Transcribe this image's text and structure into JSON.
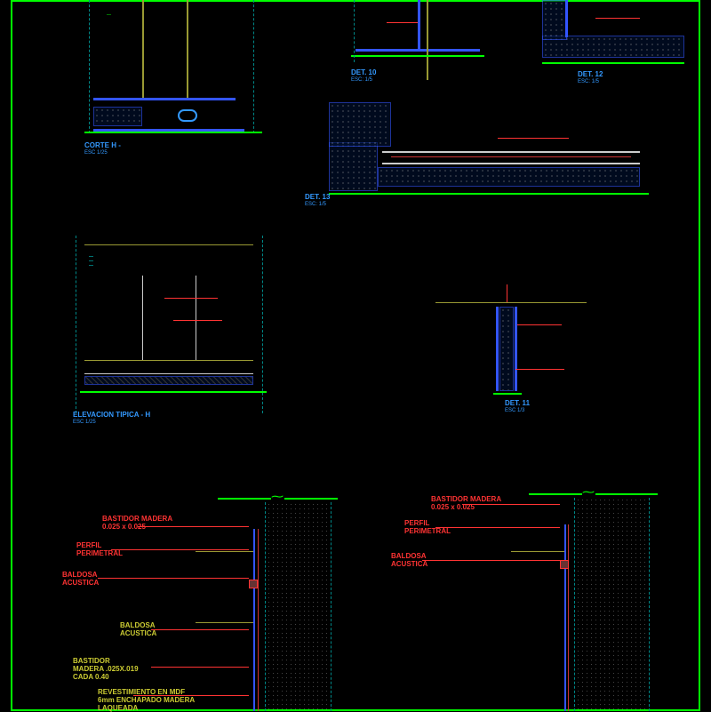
{
  "titles": {
    "corteH": {
      "main": "CORTE H -",
      "sub": "ESC 1/25"
    },
    "det10": {
      "main": "DET. 10",
      "sub": "ESC: 1/5"
    },
    "det12": {
      "main": "DET. 12",
      "sub": "ESC: 1/5"
    },
    "det13": {
      "main": "DET. 13",
      "sub": "ESC: 1/5"
    },
    "det11": {
      "main": "DET. 11",
      "sub": "ESC 1/3"
    },
    "elev": {
      "main": "ELEVACION TIPICA - H",
      "sub": "ESC 1/25"
    }
  },
  "labels": {
    "bastidor1": "BASTIDOR MADERA\n0.025 x 0.025",
    "perfilPer": "PERFIL\nPERIMETRAL",
    "baldosaAc": "BALDOSA\nACUSTICA",
    "bastidor2": "BASTIDOR\nMADERA .025X.019\nCADA 0.40",
    "revest": "REVESTIMIENTO EN MDF\n6mm ENCHAPADO MADERA\nLAQUEADA",
    "bastidor3": "BASTIDOR MADERA\n0.025 x 0.025",
    "perfilPer2": "PERFIL\nPERIMETRAL",
    "baldosaAc2": "BALDOSA\nACUSTICA"
  }
}
